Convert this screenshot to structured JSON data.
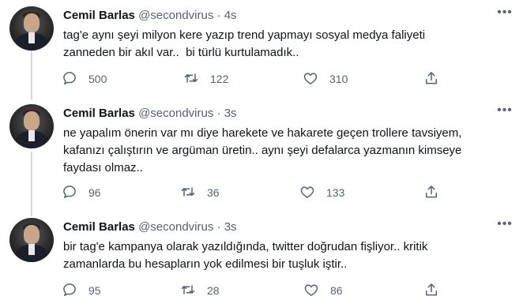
{
  "tweets": [
    {
      "author_name": "Cemil Barlas",
      "author_handle": "@secondvirus",
      "separator": "·",
      "time": "4s",
      "text": "tag'e aynı şeyi milyon kere yazıp trend yapmayı sosyal medya faliyeti\nzanneden bir akıl var..  bi türlü kurtulamadık..",
      "replies": "500",
      "retweets": "122",
      "likes": "310"
    },
    {
      "author_name": "Cemil Barlas",
      "author_handle": "@secondvirus",
      "separator": "·",
      "time": "3s",
      "text": "ne yapalım önerin var mı diye harekete ve hakarete geçen trollere tavsiyem,\nkafanızı çalıştırın ve argüman üretin.. aynı şeyi defalarca yazmanın kimseye\nfaydası olmaz..",
      "replies": "96",
      "retweets": "36",
      "likes": "133"
    },
    {
      "author_name": "Cemil Barlas",
      "author_handle": "@secondvirus",
      "separator": "·",
      "time": "3s",
      "text": "bir tag'e kampanya olarak yazıldığında, twitter doğrudan fişliyor.. kritik\nzamanlarda bu hesapların yok edilmesi bir tuşluk iştir..",
      "replies": "95",
      "retweets": "28",
      "likes": "86"
    }
  ],
  "icons": {
    "more": "more-icon",
    "reply": "reply-icon",
    "retweet": "retweet-icon",
    "like": "like-icon",
    "share": "share-icon"
  },
  "colors": {
    "text": "#0f1419",
    "secondary": "#536471",
    "thread_line": "#cfd9de",
    "background": "#ffffff"
  }
}
